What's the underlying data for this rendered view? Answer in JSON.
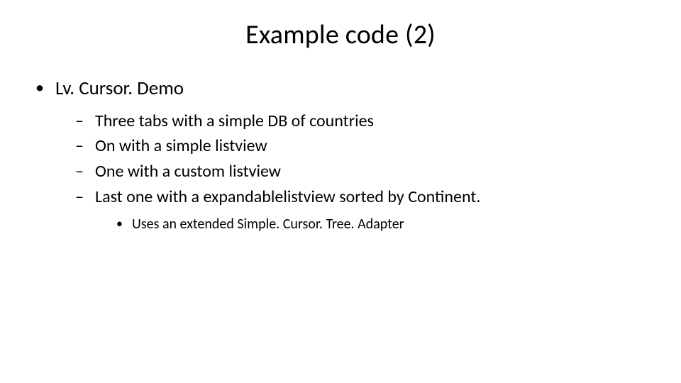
{
  "title": "Example code (2)",
  "bullets": {
    "item1": {
      "text": "Lv. Cursor. Demo",
      "sub": {
        "s1": "Three tabs with a simple DB of countries",
        "s2": "On with a simple listview",
        "s3": "One with a custom listview",
        "s4": {
          "text": "Last one with a expandablelistview sorted by Continent.",
          "sub": {
            "t1": "Uses an extended Simple. Cursor. Tree. Adapter"
          }
        }
      }
    }
  }
}
